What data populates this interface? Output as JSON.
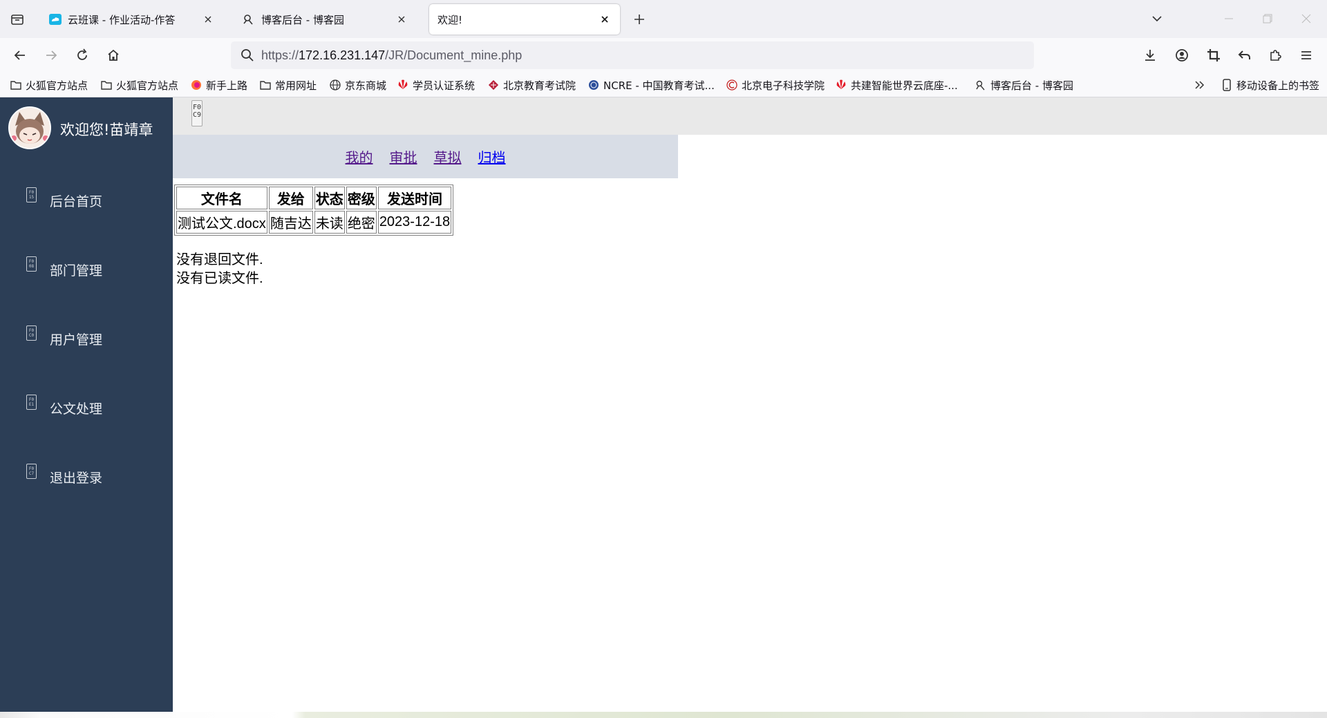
{
  "browser": {
    "tabs": [
      {
        "title": "云班课 - 作业活动-作答",
        "active": false,
        "favicon": "cloud-class-icon"
      },
      {
        "title": "博客后台 - 博客园",
        "active": false,
        "favicon": "cnblogs-icon"
      },
      {
        "title": "欢迎!",
        "active": true,
        "favicon": ""
      }
    ],
    "url": {
      "prefix": "https://",
      "host": "172.16.231.147",
      "path": "/JR/Document_mine.php"
    },
    "bookmarks": [
      {
        "label": "火狐官方站点",
        "icon": "folder-icon"
      },
      {
        "label": "火狐官方站点",
        "icon": "folder-icon"
      },
      {
        "label": "新手上路",
        "icon": "firefox-icon"
      },
      {
        "label": "常用网址",
        "icon": "folder-icon"
      },
      {
        "label": "京东商城",
        "icon": "globe-icon"
      },
      {
        "label": "学员认证系统",
        "icon": "huawei-icon"
      },
      {
        "label": "北京教育考试院",
        "icon": "bjeea-icon"
      },
      {
        "label": "NCRE - 中国教育考试...",
        "icon": "ncre-icon"
      },
      {
        "label": "北京电子科技学院",
        "icon": "besti-icon"
      },
      {
        "label": "共建智能世界云底座-...",
        "icon": "huawei-icon"
      },
      {
        "label": "博客后台 - 博客园",
        "icon": "cnblogs-icon"
      }
    ],
    "mobile_bookmarks": "移动设备上的书签"
  },
  "sidebar": {
    "welcome": "欢迎您!苗靖章",
    "items": [
      {
        "label": "后台首页",
        "glyph": "F0 15"
      },
      {
        "label": "部门管理",
        "glyph": "F0 08"
      },
      {
        "label": "用户管理",
        "glyph": "F0 C0"
      },
      {
        "label": "公文处理",
        "glyph": "F0 E1"
      },
      {
        "label": "退出登录",
        "glyph": "F0 C7"
      }
    ]
  },
  "topstrip": {
    "glyph": "F0 C9"
  },
  "subnav": {
    "links": [
      {
        "label": "我的",
        "visited": true
      },
      {
        "label": "审批",
        "visited": true
      },
      {
        "label": "草拟",
        "visited": true
      },
      {
        "label": "归档",
        "visited": false
      }
    ]
  },
  "table": {
    "headers": [
      "文件名",
      "发给",
      "状态",
      "密级",
      "发送时间"
    ],
    "rows": [
      [
        "测试公文.docx",
        "随吉达",
        "未读",
        "绝密",
        "2023-12-18"
      ]
    ]
  },
  "messages": {
    "no_returned": "没有退回文件.",
    "no_read": "没有已读文件."
  }
}
